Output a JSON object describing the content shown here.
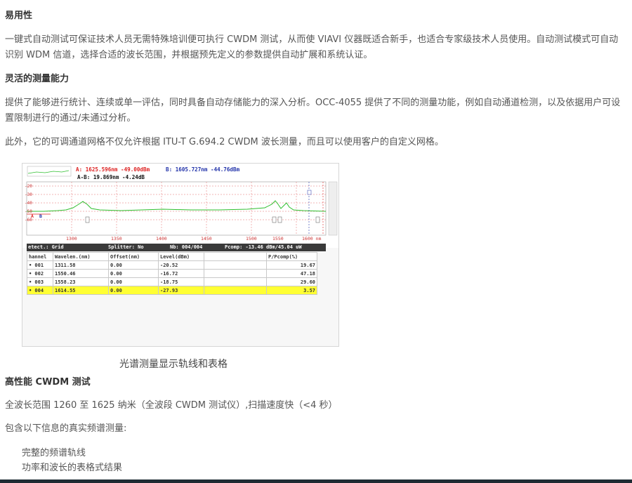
{
  "sections": [
    {
      "heading": "易用性",
      "paragraphs": [
        "一键式自动测试可保证技术人员无需特殊培训便可执行 CWDM 测试，从而使 VIAVI 仪器既适合新手，也适合专家级技术人员使用。自动测试模式可自动识别 WDM 信道，选择合适的波长范围，并根据预先定义的参数提供自动扩展和系统认证。"
      ]
    },
    {
      "heading": "灵活的测量能力",
      "paragraphs": [
        "提供了能够进行统计、连续或单一评估，同时具备自动存储能力的深入分析。OCC-4055 提供了不同的测量功能，例如自动通道检测，以及依据用户可设置限制进行的通过/未通过分析。",
        "此外，它的可调通道网格不仅允许根据 ITU-T G.694.2 CWDM 波长测量，而且可以使用客户的自定义网格。"
      ]
    }
  ],
  "figure": {
    "caption": "光谱测量显示轨线和表格",
    "marker_a": "A: 1625.596nm -49.00dBm",
    "marker_b": "B: 1605.727nm -44.76dBm",
    "marker_ab": "A-B: 19.869nm -4.24dB",
    "x_ticks": [
      "1300",
      "1350",
      "1400",
      "1450",
      "1500",
      "1550",
      "1600 nm"
    ],
    "y_ticks": [
      "-20",
      "-30",
      "-40",
      "-50",
      "-60"
    ],
    "info_detect": "etect.: Grid",
    "info_splitter": "Splitter: No",
    "info_nb": "Nb: 004/004",
    "info_pcomp": "Pcomp:  -13.46 dBm/45.04 uW",
    "table": {
      "headers": [
        "hannel",
        "Wavelen.(nm)",
        "Offset(nm)",
        "Level(dBm)",
        "",
        "P/Pcomp(%)"
      ],
      "rows": [
        [
          "• 001",
          "1311.58",
          "0.00",
          "-20.52",
          "",
          "19.67"
        ],
        [
          "• 002",
          "1550.46",
          "0.00",
          "-16.72",
          "",
          "47.18"
        ],
        [
          "• 003",
          "1558.23",
          "0.00",
          "-18.75",
          "",
          "29.60"
        ],
        [
          "• 004",
          "1614.55",
          "0.00",
          "-27.93",
          "",
          "3.57"
        ]
      ]
    }
  },
  "section3": {
    "heading": "高性能 CWDM 测试",
    "p1": "全波长范围 1260 至 1625 纳米（全波段 CWDM 测试仪）,扫描速度快（<4 秒）",
    "p2": "包含以下信息的真实频谱测量:",
    "list": [
      "完整的频谱轨线",
      "功率和波长的表格式结果"
    ]
  },
  "colors": {
    "trace": "#2fbf2f",
    "marker_a": "#dd2222",
    "marker_b": "#2233aa",
    "highlight": "#ffff33"
  }
}
